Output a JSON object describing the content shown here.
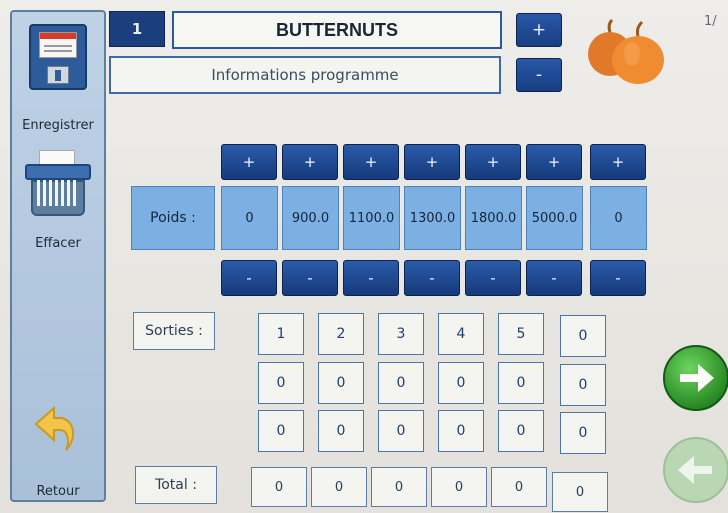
{
  "sidebar": {
    "save_label": "Enregistrer",
    "clear_label": "Effacer",
    "back_label": "Retour"
  },
  "header": {
    "program_number": "1",
    "program_name": "BUTTERNUTS",
    "info_label": "Informations programme",
    "plus_label": "+",
    "minus_label": "-",
    "page_indicator": "1/"
  },
  "grid": {
    "plus_label": "+",
    "minus_label": "-",
    "poids_label": "Poids :",
    "poids_values": [
      "0",
      "900.0",
      "1100.0",
      "1300.0",
      "1800.0",
      "5000.0",
      "0"
    ],
    "sorties_label": "Sorties :",
    "sorties_rows": [
      [
        "1",
        "2",
        "3",
        "4",
        "5",
        "0"
      ],
      [
        "0",
        "0",
        "0",
        "0",
        "0",
        "0"
      ],
      [
        "0",
        "0",
        "0",
        "0",
        "0",
        "0"
      ]
    ],
    "total_label": "Total :",
    "total_values": [
      "0",
      "0",
      "0",
      "0",
      "0",
      "0"
    ]
  },
  "icons": {
    "save": "floppy-disk-icon",
    "clear": "shredder-icon",
    "back": "return-arrow-icon",
    "next": "arrow-right-icon",
    "prev": "arrow-left-icon"
  },
  "colors": {
    "accent_dark_blue": "#1b3e7c",
    "cell_light_blue": "#7cb0e2",
    "next_green": "#2e9a2a",
    "sidebar": "#bfd2e6"
  }
}
